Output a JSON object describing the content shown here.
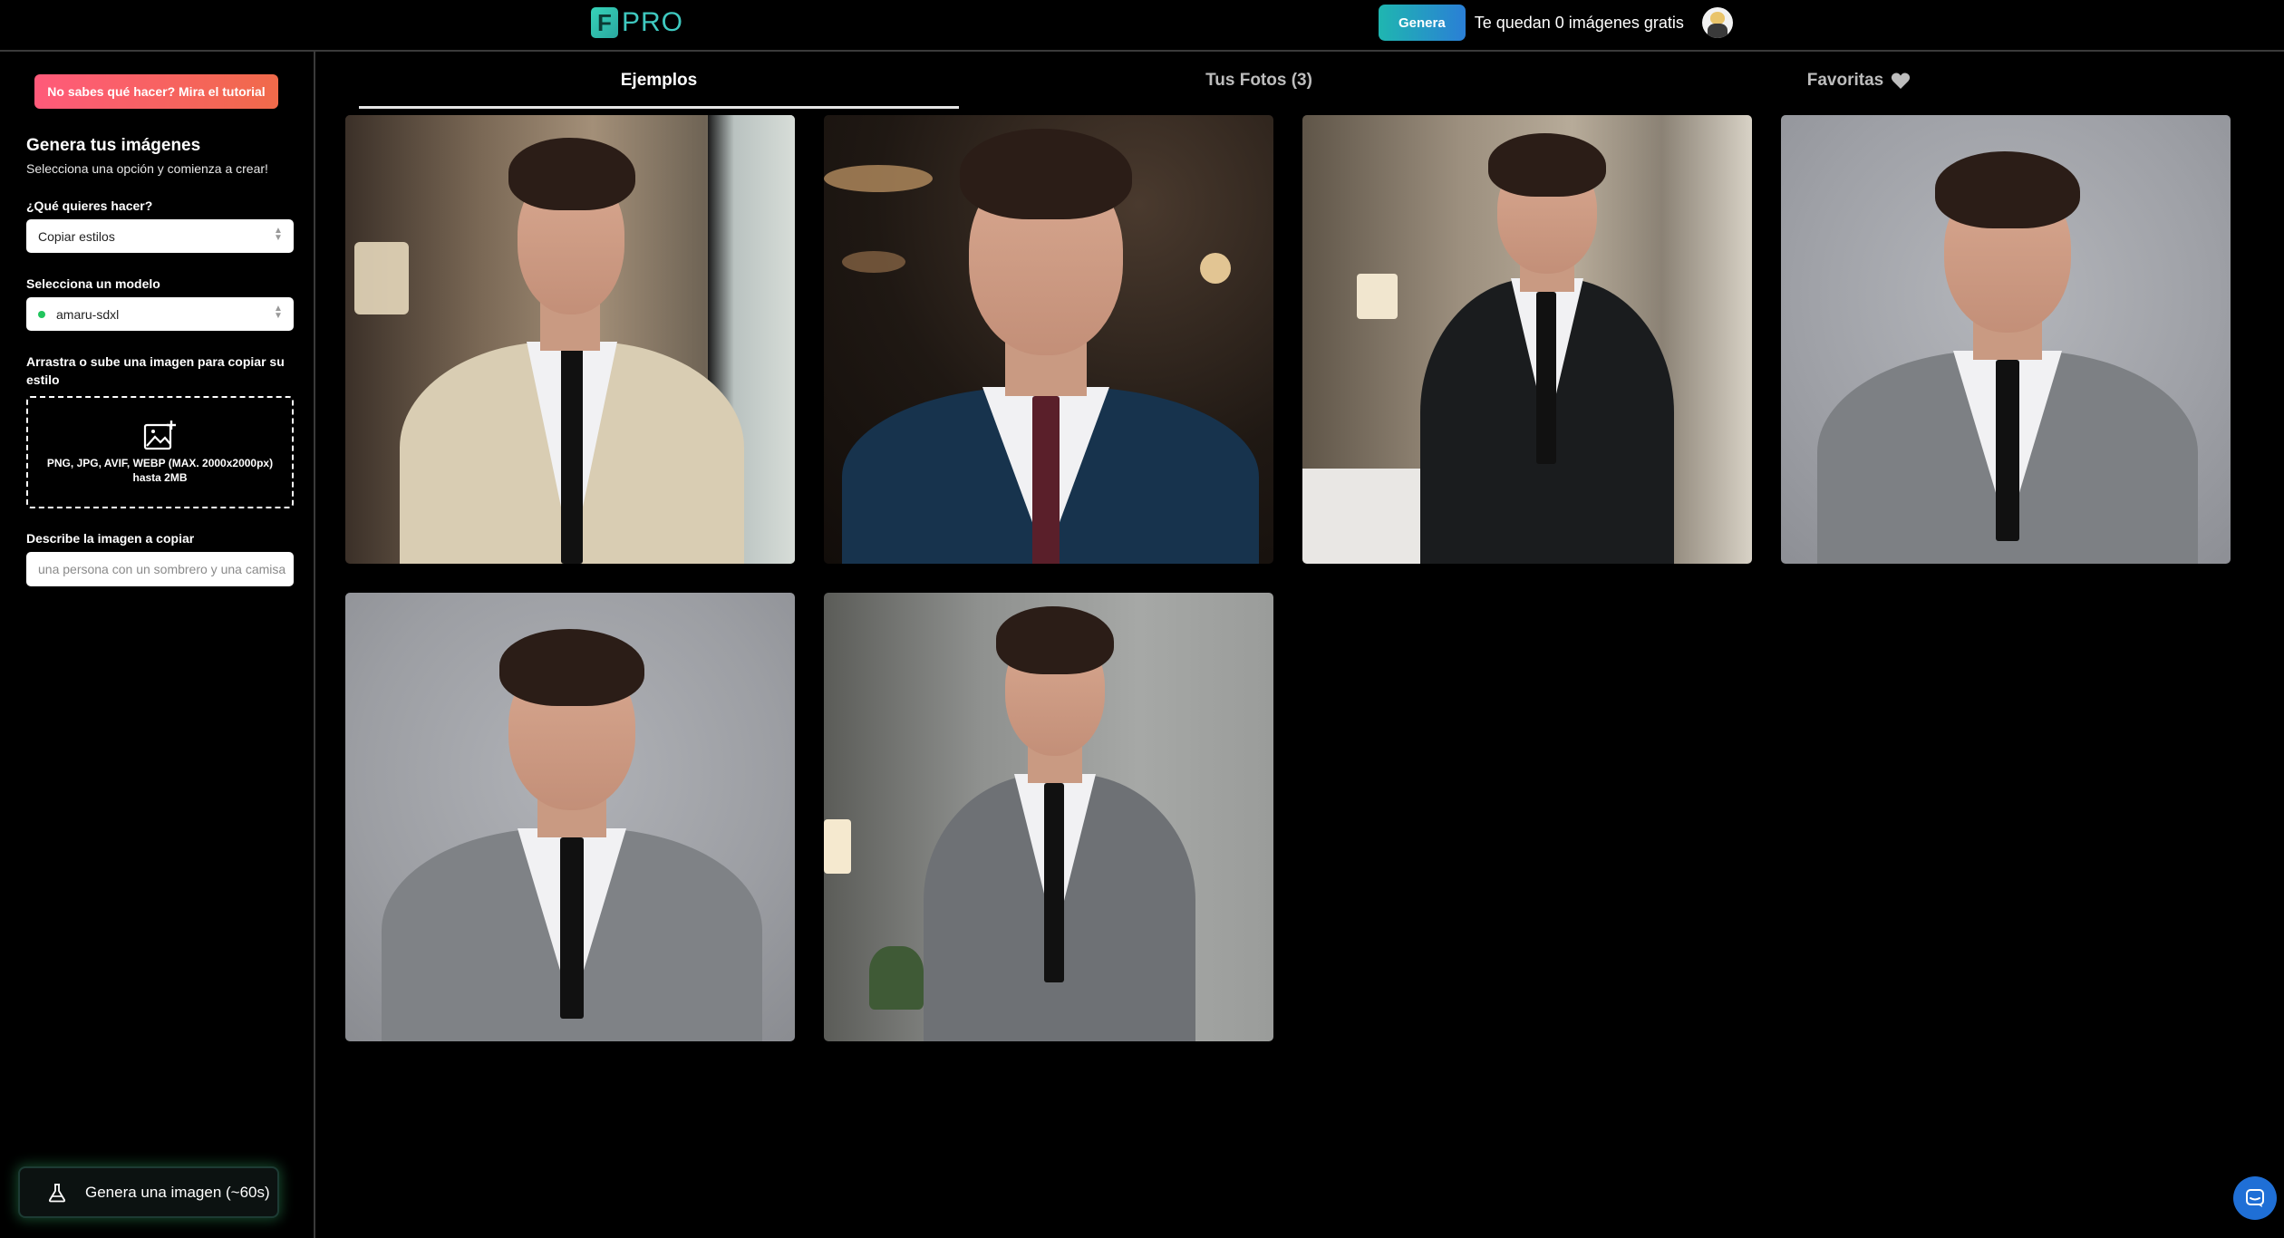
{
  "header": {
    "logo_letter": "F",
    "logo_text": "PRO",
    "generate_label": "Genera",
    "credits_text": "Te quedan 0 imágenes gratis"
  },
  "sidebar": {
    "tutorial_label": "No sabes qué hacer? Mira el tutorial",
    "title": "Genera tus imágenes",
    "subtitle": "Selecciona una opción y comienza a crear!",
    "action_label": "¿Qué quieres hacer?",
    "action_value": "Copiar estilos",
    "model_label": "Selecciona un modelo",
    "model_value": "amaru-sdxl",
    "upload_label": "Arrastra o sube una imagen para copiar su estilo",
    "upload_hint": "PNG, JPG, AVIF, WEBP (MAX. 2000x2000px) hasta 2MB",
    "describe_label": "Describe la imagen a copiar",
    "describe_placeholder": "una persona con un sombrero y una camisa",
    "generate_label": "Genera una imagen (~60s)"
  },
  "tabs": [
    {
      "label": "Ejemplos",
      "active": true
    },
    {
      "label": "Tus Fotos (3)",
      "active": false
    },
    {
      "label": "Favoritas",
      "active": false,
      "icon": "heart-icon"
    }
  ],
  "gallery": [
    {
      "alt": "example-photo-1",
      "suit": "#d9cdb3",
      "background": "#6b5a48"
    },
    {
      "alt": "example-photo-2",
      "suit": "#17334d",
      "background": "#2a211b"
    },
    {
      "alt": "example-photo-3",
      "suit": "#1a1c1e",
      "background": "#8a7f72"
    },
    {
      "alt": "example-photo-4",
      "suit": "#7d8084",
      "background": "#a7a9ae"
    },
    {
      "alt": "example-photo-5",
      "suit": "#7f8286",
      "background": "#a4a6aa"
    },
    {
      "alt": "example-photo-6",
      "suit": "#6e7175",
      "background": "#8f918f"
    }
  ],
  "colors": {
    "accent_teal": "#1fb6b0",
    "accent_blue": "#2a7fd6",
    "tutorial_pink": "#ff5a7a",
    "chat_blue": "#1f6fd6"
  }
}
